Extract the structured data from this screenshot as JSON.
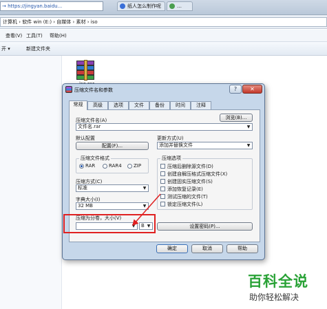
{
  "browser": {
    "url": "→ https://jingyan.baidu...",
    "tab1": "纸人怎么制作呢",
    "tab2": "…"
  },
  "explorer": {
    "address": "计算机 › 软件 win (E:) › 自媒体 › 素材 › iso",
    "menu": [
      "查看(V)",
      "工具(T)",
      "帮助(H)"
    ],
    "toolbar": [
      "开 ▾",
      "新建文件夹"
    ],
    "file_caption": "iso.rar"
  },
  "dialog": {
    "title": "压缩文件名和参数",
    "help": "?",
    "close": "✕",
    "tabs": [
      "常规",
      "高级",
      "选项",
      "文件",
      "备份",
      "时间",
      "注释"
    ],
    "archive_name_label": "压缩文件名(A)",
    "archive_name_value": "文件名.rar",
    "browse_button": "浏览(B)...",
    "default_config_label": "默认配置",
    "profiles_button": "配置(F)...",
    "update_mode_label": "更新方式(U)",
    "update_mode_value": "添加并替换文件",
    "format_group": "压缩文件格式",
    "format_options": [
      "RAR",
      "RAR4",
      "ZIP"
    ],
    "format_selected": "RAR",
    "method_label": "压缩方式(C)",
    "method_value": "标准",
    "dict_label": "字典大小(I)",
    "dict_value": "32 MB",
    "split_label": "压缩为分卷，大小(V)",
    "split_unit": "B",
    "options_group": "压缩选项",
    "options": [
      "压缩后删除源文件(D)",
      "创建自解压格式压缩文件(X)",
      "创建固实压缩文件(S)",
      "添加恢复记录(E)",
      "测试压缩的文件(T)",
      "锁定压缩文件(L)"
    ],
    "password_button": "设置密码(P)...",
    "ok_button": "确定",
    "cancel_button": "取消",
    "help_button": "帮助"
  },
  "watermark": {
    "big": "百科全说",
    "small": "助你轻松解决"
  },
  "colors": {
    "highlight_red": "#e02020",
    "selection_blue": "#3166c5",
    "watermark_green": "#29a236",
    "dialog_frame": "#c6d7ea"
  }
}
